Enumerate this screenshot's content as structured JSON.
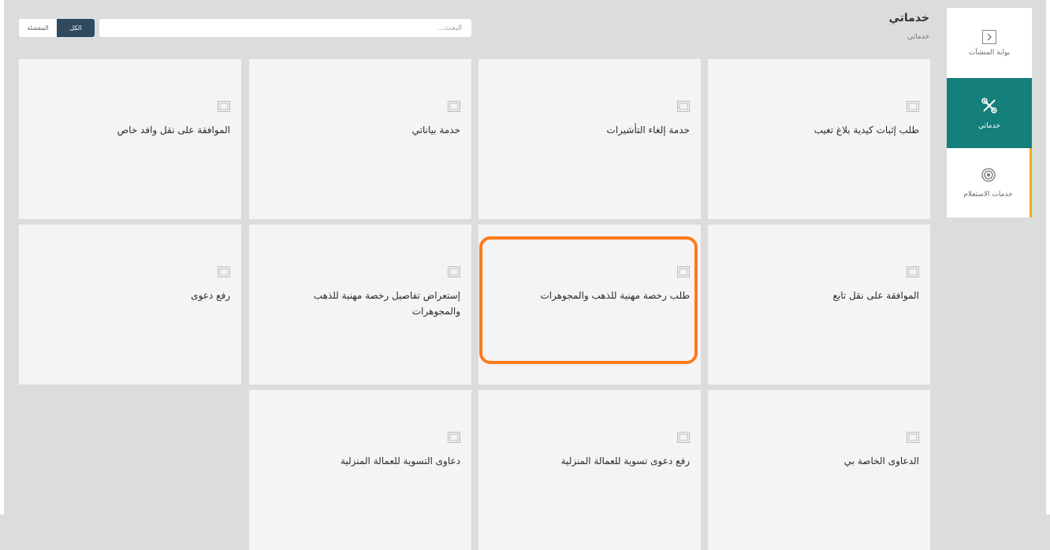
{
  "sidebar": {
    "items": [
      {
        "label": "بوابة المنشآت",
        "icon": "chevron-right-icon"
      },
      {
        "label": "خدماتي",
        "icon": "tools-icon"
      },
      {
        "label": "خدمات الاستعلام",
        "icon": "broadcast-icon"
      }
    ]
  },
  "header": {
    "title": "خدماتي",
    "breadcrumb": "خدماتي"
  },
  "search": {
    "placeholder": "البحث...",
    "value": ""
  },
  "filters": {
    "all_label": "الكل",
    "favorites_label": "المفضلة"
  },
  "cards": [
    {
      "title": "طلب إثبات كيدية بلاغ تغيب",
      "icon": "image-icon"
    },
    {
      "title": "خدمة إلغاء التأشيرات",
      "icon": "image-icon"
    },
    {
      "title": "خدمة بياناتي",
      "icon": "image-icon"
    },
    {
      "title": "الموافقة على نقل وافد خاص",
      "icon": "image-icon"
    },
    {
      "title": "الموافقة على نقل تابع",
      "icon": "image-icon"
    },
    {
      "title": "طلب رخصة مهنية للذهب والمجوهرات",
      "icon": "image-icon"
    },
    {
      "title": "إستعراض تفاصيل رخصة مهنية للذهب والمجوهرات",
      "icon": "image-icon"
    },
    {
      "title": "رفع دعوى",
      "icon": "image-icon"
    },
    {
      "title": "الدعاوى الخاصة بي",
      "icon": "image-icon"
    },
    {
      "title": "رفع دعوى تسوية للعمالة المنزلية",
      "icon": "image-icon"
    },
    {
      "title": "دعاوى التسوية للعمالة المنزلية",
      "icon": "image-icon"
    }
  ],
  "colors": {
    "accent": "#157f7b",
    "highlight": "#ff7a1a",
    "filter_active": "#2f4a5f",
    "inquiry_border": "#f4b000"
  }
}
